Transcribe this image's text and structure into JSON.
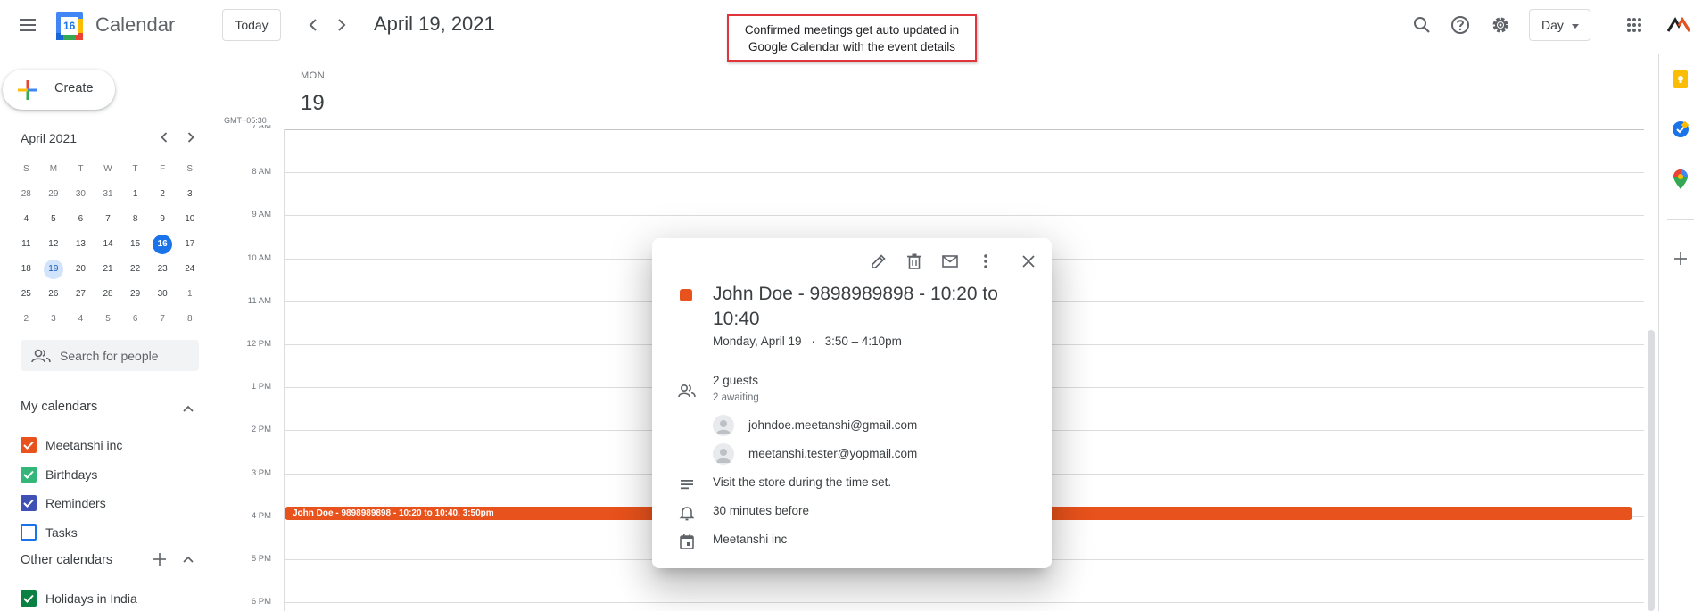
{
  "header": {
    "app_title": "Calendar",
    "logo_day": "16",
    "today_label": "Today",
    "date_title": "April 19, 2021",
    "view_label": "Day"
  },
  "annotation": {
    "line1": "Confirmed meetings get auto updated in",
    "line2": "Google Calendar with the event details"
  },
  "sidebar": {
    "create_label": "Create",
    "mini_calendar": {
      "title": "April 2021",
      "weekdays": [
        "S",
        "M",
        "T",
        "W",
        "T",
        "F",
        "S"
      ],
      "weeks": [
        [
          "28",
          "29",
          "30",
          "31",
          "1",
          "2",
          "3"
        ],
        [
          "4",
          "5",
          "6",
          "7",
          "8",
          "9",
          "10"
        ],
        [
          "11",
          "12",
          "13",
          "14",
          "15",
          "16",
          "17"
        ],
        [
          "18",
          "19",
          "20",
          "21",
          "22",
          "23",
          "24"
        ],
        [
          "25",
          "26",
          "27",
          "28",
          "29",
          "30",
          "1"
        ],
        [
          "2",
          "3",
          "4",
          "5",
          "6",
          "7",
          "8"
        ]
      ],
      "today": "16",
      "selected": "19"
    },
    "search_people_placeholder": "Search for people",
    "my_calendars_title": "My calendars",
    "my_calendars": [
      {
        "label": "Meetanshi inc",
        "color": "#e8521c",
        "checked": true
      },
      {
        "label": "Birthdays",
        "color": "#33b679",
        "checked": true
      },
      {
        "label": "Reminders",
        "color": "#3f51b5",
        "checked": true
      },
      {
        "label": "Tasks",
        "color": "#1a73e8",
        "checked": false
      }
    ],
    "other_calendars_title": "Other calendars",
    "other_calendars": [
      {
        "label": "Holidays in India",
        "color": "#0b8043",
        "checked": true
      }
    ]
  },
  "day_view": {
    "dow": "MON",
    "day_number": "19",
    "timezone": "GMT+05:30",
    "hours": [
      "7 AM",
      "8 AM",
      "9 AM",
      "10 AM",
      "11 AM",
      "12 PM",
      "1 PM",
      "2 PM",
      "3 PM",
      "4 PM",
      "5 PM",
      "6 PM"
    ],
    "event_bar_label": "John Doe - 9898989898 - 10:20 to 10:40, 3:50pm"
  },
  "popup": {
    "title": "John Doe - 9898989898 - 10:20 to 10:40",
    "when_date": "Monday, April 19",
    "when_sep": "·",
    "when_time": "3:50 – 4:10pm",
    "guests_title": "2 guests",
    "guests_sub": "2 awaiting",
    "guests": [
      "johndoe.meetanshi@gmail.com",
      "meetanshi.tester@yopmail.com"
    ],
    "description": "Visit the store during the time set.",
    "reminder": "30 minutes before",
    "calendar": "Meetanshi inc",
    "event_color": "#e8521c"
  }
}
